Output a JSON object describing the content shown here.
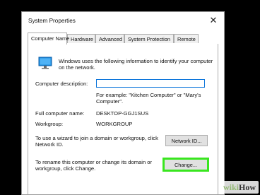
{
  "window": {
    "title": "System Properties",
    "close_glyph": "✕"
  },
  "tabs": [
    {
      "label": "Computer Name",
      "active": true
    },
    {
      "label": "Hardware",
      "active": false
    },
    {
      "label": "Advanced",
      "active": false
    },
    {
      "label": "System Protection",
      "active": false
    },
    {
      "label": "Remote",
      "active": false
    }
  ],
  "computer_name_tab": {
    "intro_line1": "Windows uses the following information to identify your computer",
    "intro_line2": "on the network.",
    "description_label": "Computer description:",
    "description_value": "",
    "example_line1": "For example: \"Kitchen Computer\" or \"Mary's",
    "example_line2": "Computer\".",
    "full_name_label": "Full computer name:",
    "full_name_value": "DESKTOP-GGJ1SUS",
    "workgroup_label": "Workgroup:",
    "workgroup_value": "WORKGROUP",
    "network_text_line1": "To use a wizard to join a domain or workgroup, click",
    "network_text_line2": "Network ID.",
    "network_id_button": "Network ID...",
    "rename_text_line1": "To rename this computer or change its domain or",
    "rename_text_line2": "workgroup, click Change.",
    "change_button": "Change..."
  },
  "highlight_color": "#39e61f",
  "watermark": {
    "part1": "wiki",
    "part2": "How"
  }
}
